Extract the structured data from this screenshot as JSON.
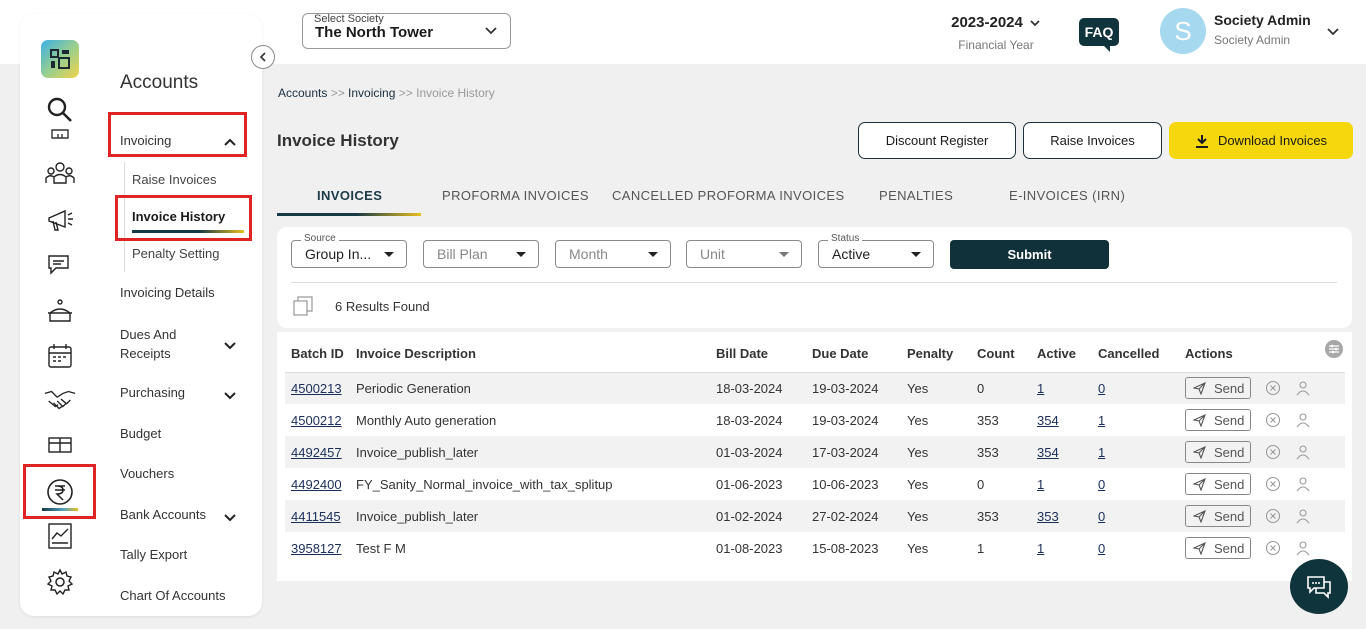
{
  "header": {
    "society_label": "Select Society",
    "society_value": "The North Tower",
    "financial_year": "2023-2024",
    "financial_year_label": "Financial Year",
    "faq": "FAQ",
    "avatar_letter": "S",
    "user_name": "Society Admin",
    "user_role": "Society Admin"
  },
  "sidebar": {
    "title": "Accounts",
    "items": [
      {
        "label": "Invoicing"
      },
      {
        "label": "Invoicing Details"
      },
      {
        "label": "Dues And Receipts"
      },
      {
        "label": "Purchasing"
      },
      {
        "label": "Budget"
      },
      {
        "label": "Vouchers"
      },
      {
        "label": "Bank Accounts"
      },
      {
        "label": "Tally Export"
      },
      {
        "label": "Chart Of Accounts"
      }
    ],
    "submenu": [
      {
        "label": "Raise Invoices"
      },
      {
        "label": "Invoice History"
      },
      {
        "label": "Penalty Setting"
      }
    ]
  },
  "breadcrumb": {
    "root": "Accounts",
    "sep1": " >> ",
    "mid": "Invoicing",
    "sep2": " >> ",
    "current": "Invoice History"
  },
  "page": {
    "title": "Invoice History",
    "discount_register": "Discount Register",
    "raise_invoices": "Raise Invoices",
    "download_invoices": "Download Invoices"
  },
  "tabs": [
    {
      "label": "INVOICES"
    },
    {
      "label": "PROFORMA INVOICES"
    },
    {
      "label": "CANCELLED PROFORMA INVOICES"
    },
    {
      "label": "PENALTIES"
    },
    {
      "label": "E-INVOICES (IRN)"
    }
  ],
  "filters": {
    "source_label": "Source",
    "source_value": "Group In...",
    "bill_plan_placeholder": "Bill Plan",
    "month_placeholder": "Month",
    "unit_placeholder": "Unit",
    "status_label": "Status",
    "status_value": "Active",
    "submit": "Submit",
    "results": "6 Results Found"
  },
  "table": {
    "columns": [
      "Batch ID",
      "Invoice Description",
      "Bill Date",
      "Due Date",
      "Penalty",
      "Count",
      "Active",
      "Cancelled",
      "Actions"
    ],
    "send_label": "Send",
    "rows": [
      {
        "batch_id": "4500213",
        "description": "Periodic Generation",
        "bill_date": "18-03-2024",
        "due_date": "19-03-2024",
        "penalty": "Yes",
        "count": "0",
        "active": "1",
        "cancelled": "0"
      },
      {
        "batch_id": "4500212",
        "description": "Monthly Auto generation",
        "bill_date": "18-03-2024",
        "due_date": "19-03-2024",
        "penalty": "Yes",
        "count": "353",
        "active": "354",
        "cancelled": "1"
      },
      {
        "batch_id": "4492457",
        "description": "Invoice_publish_later",
        "bill_date": "01-03-2024",
        "due_date": "17-03-2024",
        "penalty": "Yes",
        "count": "353",
        "active": "354",
        "cancelled": "1"
      },
      {
        "batch_id": "4492400",
        "description": "FY_Sanity_Normal_invoice_with_tax_splitup",
        "bill_date": "01-06-2023",
        "due_date": "10-06-2023",
        "penalty": "Yes",
        "count": "0",
        "active": "1",
        "cancelled": "0"
      },
      {
        "batch_id": "4411545",
        "description": "Invoice_publish_later",
        "bill_date": "01-02-2024",
        "due_date": "27-02-2024",
        "penalty": "Yes",
        "count": "353",
        "active": "353",
        "cancelled": "0"
      },
      {
        "batch_id": "3958127",
        "description": "Test F M",
        "bill_date": "01-08-2023",
        "due_date": "15-08-2023",
        "penalty": "Yes",
        "count": "1",
        "active": "1",
        "cancelled": "0"
      }
    ]
  }
}
